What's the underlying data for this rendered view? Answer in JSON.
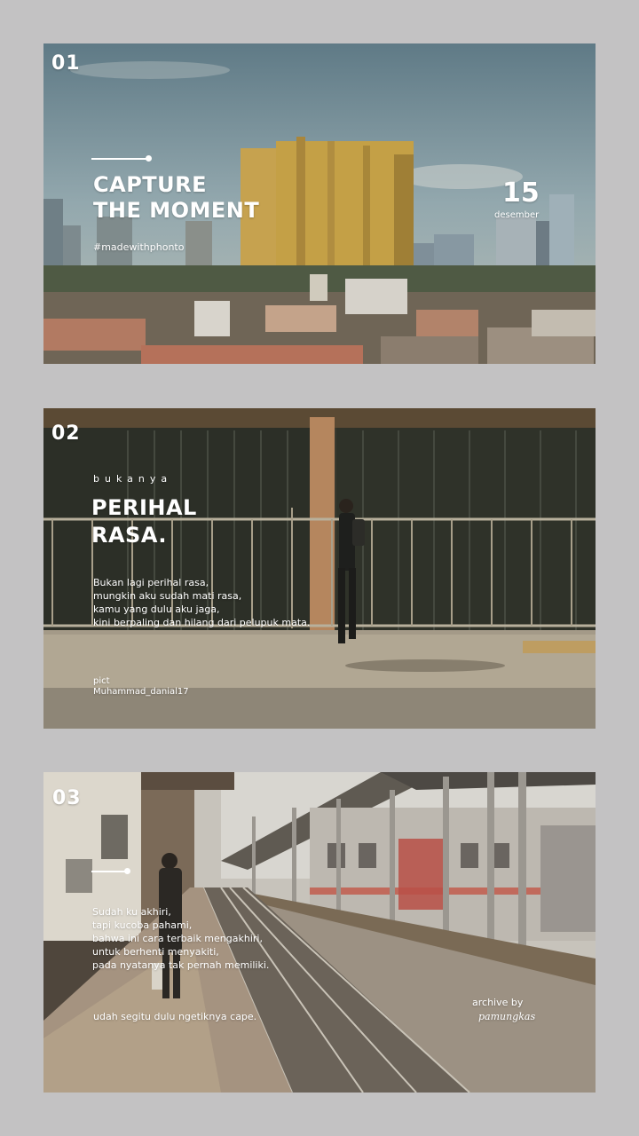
{
  "panel1": {
    "number": "01",
    "title_line1": "CAPTURE",
    "title_line2": "THE MOMENT",
    "hashtag": "#madewithphonto",
    "day": "15",
    "month": "desember"
  },
  "panel2": {
    "number": "02",
    "kicker": "bukanya",
    "title_line1": "PERIHAL",
    "title_line2": "RASA.",
    "verse": "Bukan lagi perihal rasa,\nmungkin aku sudah mati rasa,\nkamu yang dulu aku jaga,\nkini berpaling dan hilang dari pelupuk mata.",
    "credit_label": "pict",
    "credit_name": "Muhammad_danial17"
  },
  "panel3": {
    "number": "03",
    "verse": "Sudah ku akhiri,\ntapi kucoba pahami,\nbahwa ini cara terbaik mengakhiri,\nuntuk berhenti menyakiti,\npada nyatanya tak pernah memiliki.",
    "footer": "udah segitu dulu ngetiknya cape.",
    "archive_label": "archive by",
    "signature": "pamungkas"
  }
}
